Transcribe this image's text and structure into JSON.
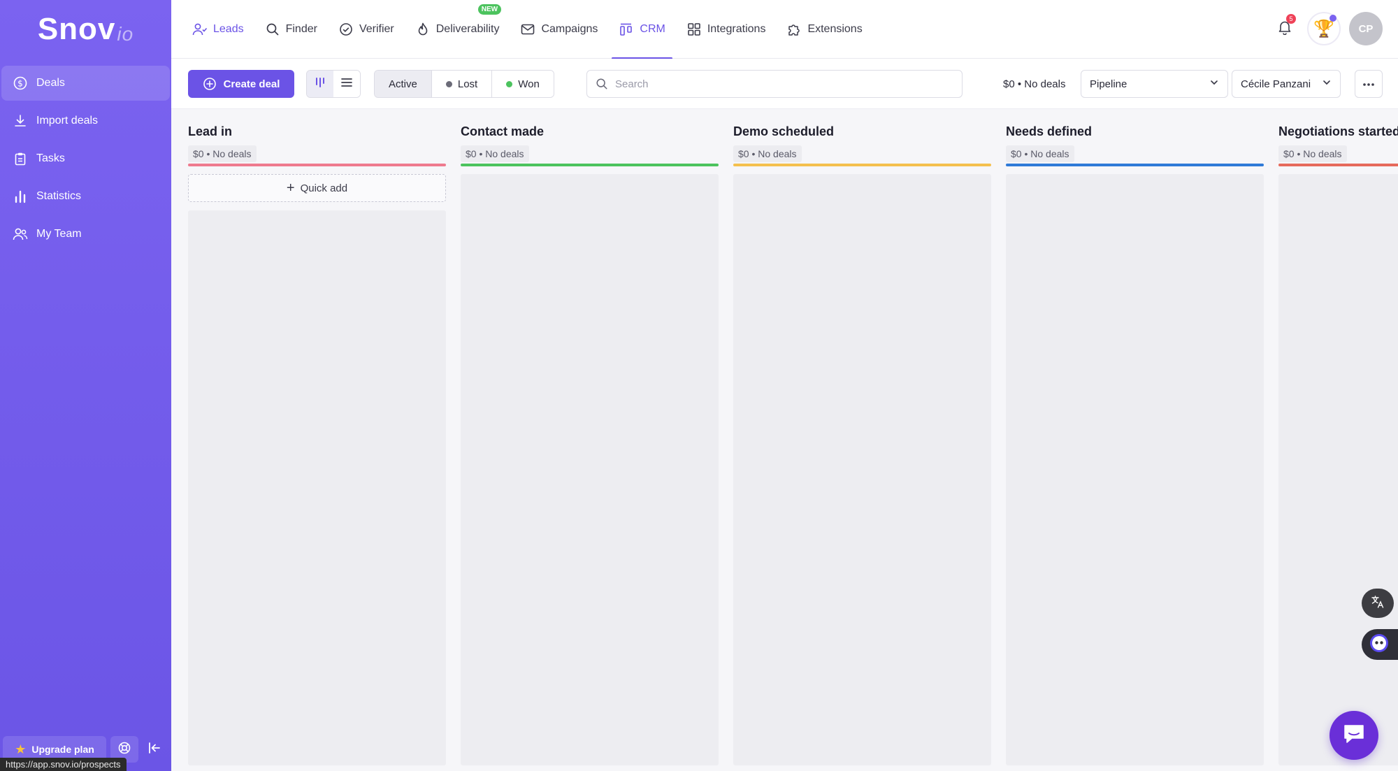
{
  "brand": {
    "name": "Snov",
    "suffix": "io"
  },
  "sidebar": {
    "items": [
      {
        "label": "Deals",
        "icon": "dollar-circle-icon",
        "active": true
      },
      {
        "label": "Import deals",
        "icon": "download-icon"
      },
      {
        "label": "Tasks",
        "icon": "clipboard-icon"
      },
      {
        "label": "Statistics",
        "icon": "bar-chart-icon"
      },
      {
        "label": "My Team",
        "icon": "team-icon"
      }
    ],
    "upgrade_label": "Upgrade plan",
    "status_url": "https://app.snov.io/prospects"
  },
  "topnav": {
    "items": [
      {
        "label": "Leads",
        "icon": "users-icon"
      },
      {
        "label": "Finder",
        "icon": "search-icon"
      },
      {
        "label": "Verifier",
        "icon": "check-circle-icon"
      },
      {
        "label": "Deliverability",
        "icon": "flame-icon",
        "badge": "NEW"
      },
      {
        "label": "Campaigns",
        "icon": "mail-icon"
      },
      {
        "label": "CRM",
        "icon": "crm-icon",
        "active": true
      },
      {
        "label": "Integrations",
        "icon": "grid-icon"
      },
      {
        "label": "Extensions",
        "icon": "puzzle-icon"
      }
    ],
    "notification_count": "5",
    "avatar_initials": "CP"
  },
  "toolbar": {
    "create_label": "Create deal",
    "status_tabs": [
      {
        "label": "Active",
        "active": true
      },
      {
        "label": "Lost",
        "dot_color": "#6b6b78"
      },
      {
        "label": "Won",
        "dot_color": "#4cc35e"
      }
    ],
    "search_placeholder": "Search",
    "summary": "$0 • No deals",
    "pipeline_select": "Pipeline",
    "owner_select": "Cécile Panzani"
  },
  "board": {
    "quick_add_label": "Quick add",
    "columns": [
      {
        "title": "Lead in",
        "summary": "$0 • No deals",
        "color": "#ee7a8e"
      },
      {
        "title": "Contact made",
        "summary": "$0 • No deals",
        "color": "#4cc35e"
      },
      {
        "title": "Demo scheduled",
        "summary": "$0 • No deals",
        "color": "#f4c04e"
      },
      {
        "title": "Needs defined",
        "summary": "$0 • No deals",
        "color": "#2f7ad8"
      },
      {
        "title": "Negotiations started",
        "summary": "$0 • No deals",
        "color": "#e66a5c"
      }
    ]
  }
}
